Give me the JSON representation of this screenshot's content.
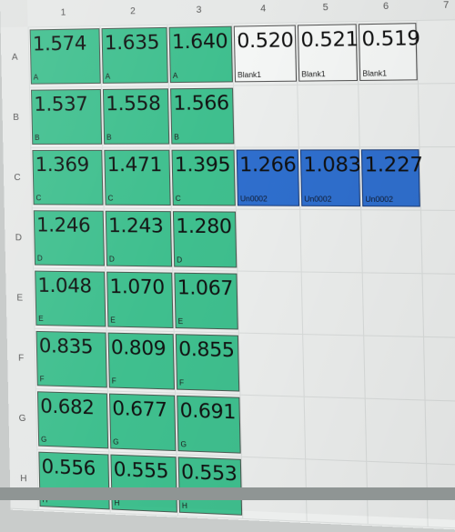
{
  "columns": [
    "1",
    "2",
    "3",
    "4",
    "5",
    "6",
    "7"
  ],
  "rows": [
    "A",
    "B",
    "C",
    "D",
    "E",
    "F",
    "G",
    "H"
  ],
  "wells": {
    "A": [
      {
        "value": "1.574",
        "label": "A",
        "type": "green"
      },
      {
        "value": "1.635",
        "label": "A",
        "type": "green"
      },
      {
        "value": "1.640",
        "label": "A",
        "type": "green"
      },
      {
        "value": "0.520",
        "label": "Blank1",
        "type": "white"
      },
      {
        "value": "0.521",
        "label": "Blank1",
        "type": "white"
      },
      {
        "value": "0.519",
        "label": "Blank1",
        "type": "white"
      }
    ],
    "B": [
      {
        "value": "1.537",
        "label": "B",
        "type": "green"
      },
      {
        "value": "1.558",
        "label": "B",
        "type": "green"
      },
      {
        "value": "1.566",
        "label": "B",
        "type": "green"
      }
    ],
    "C": [
      {
        "value": "1.369",
        "label": "C",
        "type": "green"
      },
      {
        "value": "1.471",
        "label": "C",
        "type": "green"
      },
      {
        "value": "1.395",
        "label": "C",
        "type": "green"
      },
      {
        "value": "1.266",
        "label": "Un0002",
        "type": "blue"
      },
      {
        "value": "1.083",
        "label": "Un0002",
        "type": "blue"
      },
      {
        "value": "1.227",
        "label": "Un0002",
        "type": "blue"
      }
    ],
    "D": [
      {
        "value": "1.246",
        "label": "D",
        "type": "green"
      },
      {
        "value": "1.243",
        "label": "D",
        "type": "green"
      },
      {
        "value": "1.280",
        "label": "D",
        "type": "green"
      }
    ],
    "E": [
      {
        "value": "1.048",
        "label": "E",
        "type": "green"
      },
      {
        "value": "1.070",
        "label": "E",
        "type": "green"
      },
      {
        "value": "1.067",
        "label": "E",
        "type": "green"
      }
    ],
    "F": [
      {
        "value": "0.835",
        "label": "F",
        "type": "green"
      },
      {
        "value": "0.809",
        "label": "F",
        "type": "green"
      },
      {
        "value": "0.855",
        "label": "F",
        "type": "green"
      }
    ],
    "G": [
      {
        "value": "0.682",
        "label": "G",
        "type": "green"
      },
      {
        "value": "0.677",
        "label": "G",
        "type": "green"
      },
      {
        "value": "0.691",
        "label": "G",
        "type": "green"
      }
    ],
    "H": [
      {
        "value": "0.556",
        "label": "H",
        "type": "green"
      },
      {
        "value": "0.555",
        "label": "H",
        "type": "green"
      },
      {
        "value": "0.553",
        "label": "H",
        "type": "green"
      }
    ]
  },
  "colors": {
    "green": "#3fbf8e",
    "blue": "#2f6fce",
    "blank": "#f4f6f5"
  }
}
